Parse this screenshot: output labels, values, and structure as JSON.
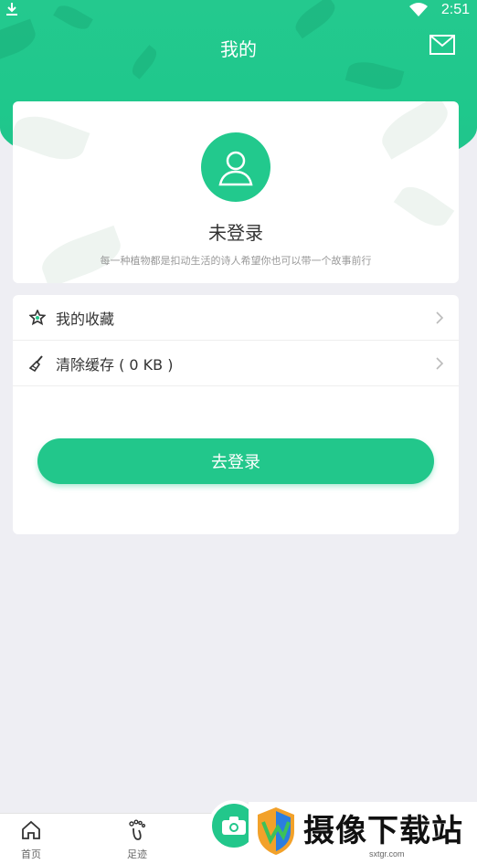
{
  "status_bar": {
    "time": "2:51"
  },
  "header": {
    "title": "我的"
  },
  "profile": {
    "login_state": "未登录",
    "slogan": "每一种植物都是扣动生活的诗人希望你也可以带一个故事前行"
  },
  "menu": {
    "items": [
      {
        "label": "我的收藏",
        "icon": "star-icon"
      },
      {
        "label": "清除缓存 ( 0 KB )",
        "icon": "broom-icon"
      }
    ],
    "login_button": "去登录"
  },
  "tab_bar": {
    "tabs": [
      {
        "label": "首页",
        "icon": "home-icon"
      },
      {
        "label": "足迹",
        "icon": "footprint-icon"
      }
    ]
  },
  "watermark": {
    "title": "摄像下载站",
    "url": "sxtgr.com"
  },
  "colors": {
    "accent": "#22c78b",
    "background": "#eeeef3"
  }
}
